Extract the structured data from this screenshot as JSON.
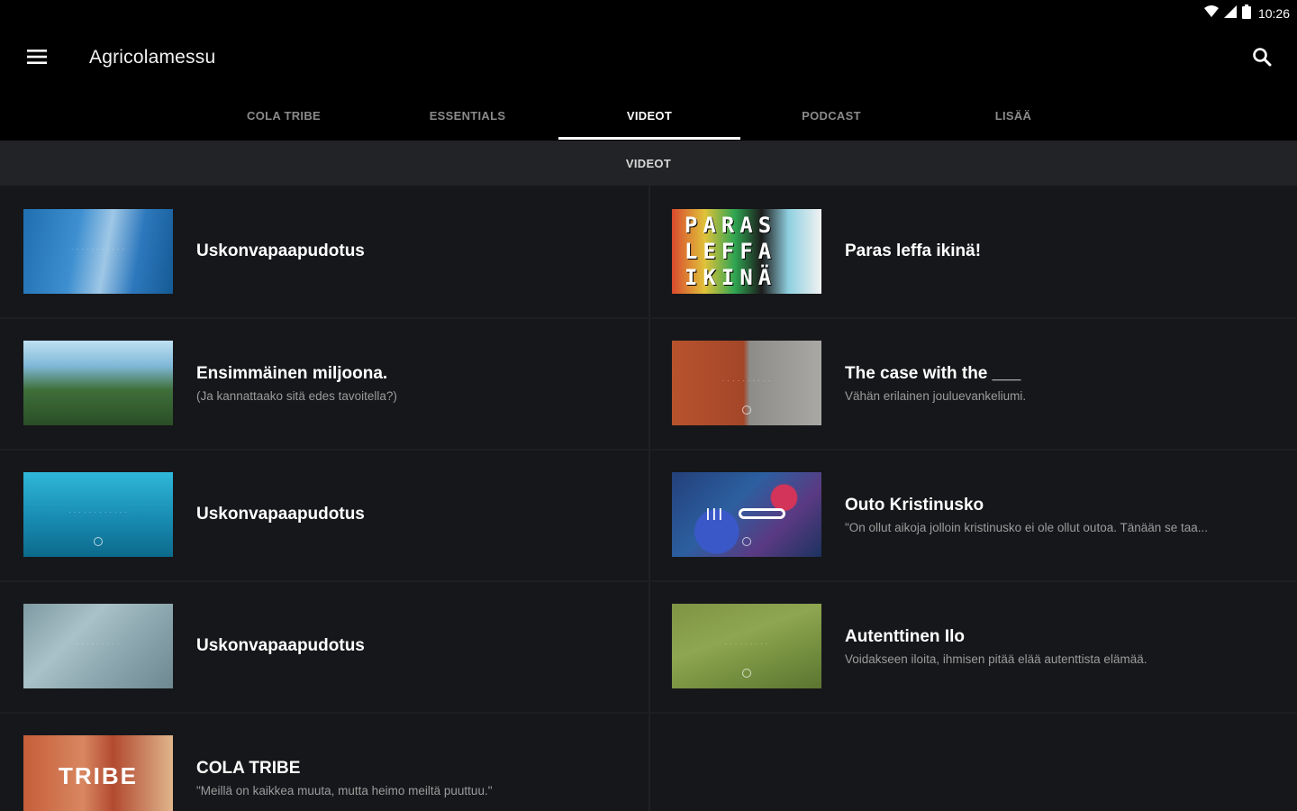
{
  "status_bar": {
    "time": "10:26"
  },
  "app_bar": {
    "title": "Agricolamessu"
  },
  "tabs": [
    {
      "label": "COLA TRIBE",
      "active": false
    },
    {
      "label": "ESSENTIALS",
      "active": false
    },
    {
      "label": "VIDEOT",
      "active": true
    },
    {
      "label": "PODCAST",
      "active": false
    },
    {
      "label": "LISÄÄ",
      "active": false
    }
  ],
  "section": {
    "title": "VIDEOT"
  },
  "videos": [
    {
      "title": "Uskonvapaapudotus",
      "subtitle": ""
    },
    {
      "title": "Paras leffa ikinä!",
      "subtitle": "",
      "thumb_text": "PARAS LEFFA IKINÄ"
    },
    {
      "title": "Ensimmäinen miljoona.",
      "subtitle": "(Ja kannattaako sitä edes tavoitella?)"
    },
    {
      "title": "The case with the ___",
      "subtitle": "Vähän erilainen jouluevankeliumi."
    },
    {
      "title": "Uskonvapaapudotus",
      "subtitle": ""
    },
    {
      "title": "Outo Kristinusko",
      "subtitle": "\"On ollut aikoja jolloin kristinusko ei ole ollut outoa. Tänään se taa..."
    },
    {
      "title": "Uskonvapaapudotus",
      "subtitle": ""
    },
    {
      "title": "Autenttinen Ilo",
      "subtitle": "Voidakseen iloita, ihmisen pitää elää autenttista elämää."
    },
    {
      "title": "COLA TRIBE",
      "subtitle": "\"Meillä on kaikkea muuta, mutta heimo meiltä puuttuu.\"",
      "thumb_text": "TRIBE"
    }
  ],
  "colors": {
    "background": "#16171a",
    "app_bar": "#000000",
    "section_header": "#222326",
    "active_tab": "#ffffff",
    "inactive_tab": "#8a8a8a"
  },
  "icons": [
    "menu-icon",
    "search-icon",
    "wifi-icon",
    "signal-icon",
    "battery-icon"
  ]
}
